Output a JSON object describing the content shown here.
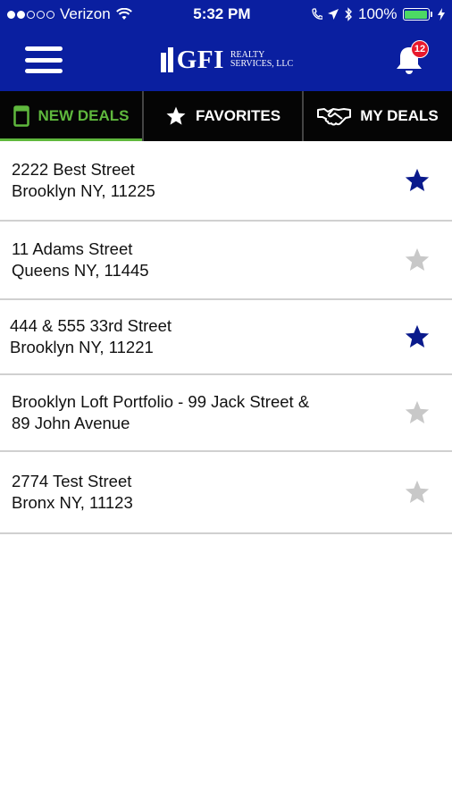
{
  "status_bar": {
    "carrier": "Verizon",
    "time": "5:32 PM",
    "battery": "100%"
  },
  "header": {
    "logo_main": "GFI",
    "logo_sub_line1": "REALTY",
    "logo_sub_line2": "SERVICES, LLC",
    "notification_count": "12"
  },
  "tabs": [
    {
      "label": "NEW DEALS",
      "icon": "tablet-icon",
      "active": true
    },
    {
      "label": "FAVORITES",
      "icon": "star-icon",
      "active": false
    },
    {
      "label": "MY DEALS",
      "icon": "handshake-icon",
      "active": false
    }
  ],
  "deals": [
    {
      "line1": "2222 Best Street",
      "line2": "Brooklyn NY, 11225",
      "favorite": true
    },
    {
      "line1": "11 Adams Street",
      "line2": "Queens NY, 11445",
      "favorite": false
    },
    {
      "line1": "444 & 555 33rd Street",
      "line2": "Brooklyn NY, 11221",
      "favorite": true
    },
    {
      "line1": "Brooklyn Loft Portfolio - 99 Jack Street &",
      "line2": "89 John Avenue",
      "favorite": false
    },
    {
      "line1": "2774 Test Street",
      "line2": "Bronx NY, 11123",
      "favorite": false
    }
  ],
  "colors": {
    "brand_blue": "#0a1fa0",
    "active_tab_green": "#5fb83d",
    "star_on": "#0a1a8c",
    "star_off": "#c8c8c8",
    "badge_red": "#e8192c"
  }
}
